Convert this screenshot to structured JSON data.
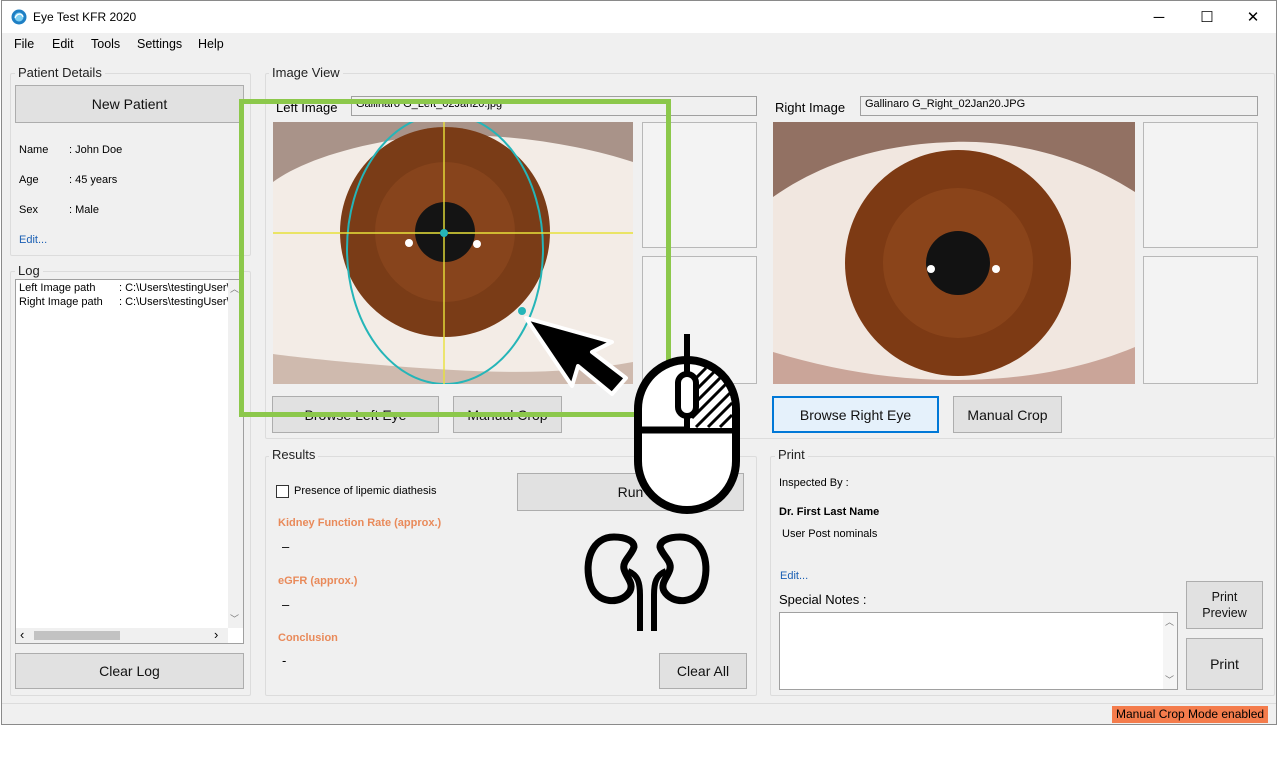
{
  "window": {
    "title": "Eye Test KFR 2020",
    "controls": {
      "minimize": "─",
      "maximize": "☐",
      "close": "✕"
    }
  },
  "menu": [
    "File",
    "Edit",
    "Tools",
    "Settings",
    "Help"
  ],
  "patient": {
    "group_title": "Patient Details",
    "new_patient": "New Patient",
    "fields": [
      {
        "label": "Name",
        "value": ": John Doe"
      },
      {
        "label": "Age",
        "value": ": 45 years"
      },
      {
        "label": "Sex",
        "value": ": Male"
      }
    ],
    "edit_link": "Edit..."
  },
  "log": {
    "group_title": "Log",
    "lines": [
      {
        "label": "Left Image path",
        "value": ": C:\\Users\\testingUser\\"
      },
      {
        "label": "Right Image path",
        "value": ": C:\\Users\\testingUser\\"
      }
    ],
    "clear_button": "Clear Log",
    "scroll": {
      "left": "‹",
      "right": "›",
      "up": "︿",
      "down": "﹀"
    }
  },
  "image_view": {
    "group_title": "Image View",
    "left": {
      "label": "Left Image",
      "filename": "Gallinaro G_Left_02Jan20.jpg",
      "browse": "Browse Left Eye",
      "crop": "Manual Crop"
    },
    "right": {
      "label": "Right Image",
      "filename": "Gallinaro G_Right_02Jan20.JPG",
      "browse": "Browse Right Eye",
      "crop": "Manual Crop"
    }
  },
  "results": {
    "group_title": "Results",
    "checkbox_label": "Presence of lipemic diathesis",
    "run_button": "Run",
    "kidney_label": "Kidney Function Rate (approx.)",
    "kidney_value": "–",
    "egfr_label": "eGFR (approx.)",
    "egfr_value": "–",
    "conclusion_label": "Conclusion",
    "conclusion_value": "-",
    "clear_all": "Clear All"
  },
  "print": {
    "group_title": "Print",
    "inspected_by": "Inspected By :",
    "doctor": "Dr. First Last Name",
    "postnominals": "User Post nominals",
    "edit_link": "Edit...",
    "notes_label": "Special Notes :",
    "print_preview": "Print Preview",
    "print": "Print"
  },
  "status": {
    "text": "Manual Crop Mode enabled",
    "color": "#f47c4c"
  },
  "colors": {
    "highlight_frame": "#8cc84b",
    "ellipse": "#25b5b8",
    "crosshair": "#e8e23a",
    "iris": "#7a3c17",
    "sclera": "#f3ece6"
  }
}
